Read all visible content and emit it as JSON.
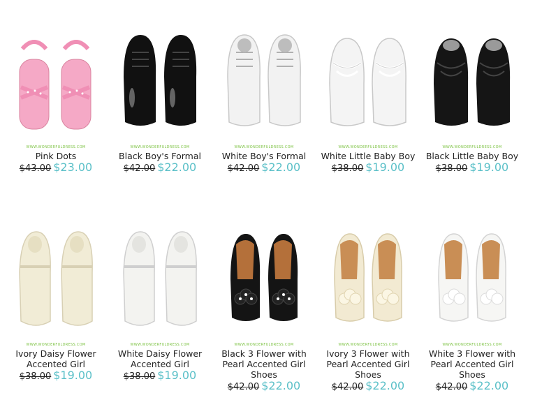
{
  "watermark_text": "WWW.WONDERFULDRESS.COM",
  "products": [
    {
      "name": "Pink Dots",
      "old_price": "$43.00",
      "new_price": "$23.00",
      "icon": "pink-sandal-icon",
      "color": "#f5a9c6"
    },
    {
      "name": "Black Boy's Formal",
      "old_price": "$42.00",
      "new_price": "$22.00",
      "icon": "black-oxford-shoe-icon",
      "color": "#111111"
    },
    {
      "name": "White Boy's Formal",
      "old_price": "$42.00",
      "new_price": "$22.00",
      "icon": "white-oxford-shoe-icon",
      "color": "#f2f2f2"
    },
    {
      "name": "White Little Baby Boy",
      "old_price": "$38.00",
      "new_price": "$19.00",
      "icon": "white-baby-shoe-icon",
      "color": "#f4f4f4"
    },
    {
      "name": "Black Little Baby Boy",
      "old_price": "$38.00",
      "new_price": "$19.00",
      "icon": "black-baby-shoe-icon",
      "color": "#151515"
    },
    {
      "name": "Ivory Daisy Flower Accented Girl",
      "old_price": "$38.00",
      "new_price": "$19.00",
      "icon": "ivory-mary-jane-icon",
      "color": "#f1ecd6"
    },
    {
      "name": "White Daisy Flower Accented Girl",
      "old_price": "$38.00",
      "new_price": "$19.00",
      "icon": "white-mary-jane-icon",
      "color": "#f3f3f0"
    },
    {
      "name": "Black 3 Flower with Pearl Accented Girl Shoes",
      "old_price": "$42.00",
      "new_price": "$22.00",
      "icon": "black-flower-flat-icon",
      "color": "#141414"
    },
    {
      "name": "Ivory 3 Flower with Pearl Accented Girl Shoes",
      "old_price": "$42.00",
      "new_price": "$22.00",
      "icon": "ivory-flower-flat-icon",
      "color": "#f2ead2"
    },
    {
      "name": "White 3 Flower with Pearl Accented Girl Shoes",
      "old_price": "$42.00",
      "new_price": "$22.00",
      "icon": "white-flower-flat-icon",
      "color": "#f6f6f4"
    }
  ]
}
